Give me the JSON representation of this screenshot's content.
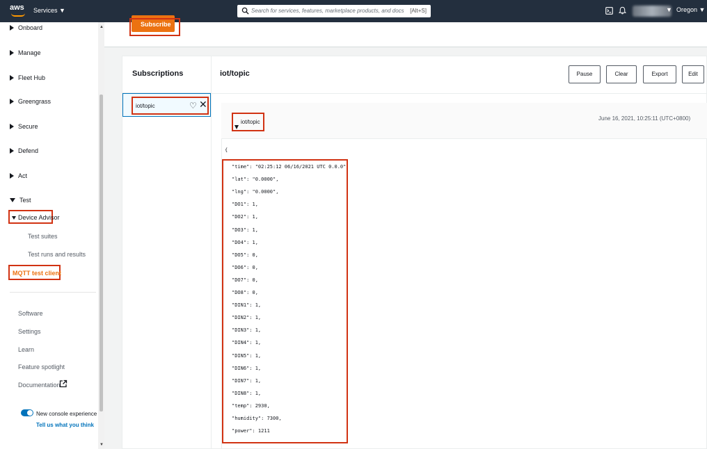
{
  "topnav": {
    "logo": "aws",
    "services_label": "Services ▼",
    "search_placeholder": "Search for services, features, marketplace products, and docs",
    "search_shortcut": "[Alt+S]",
    "region_label": "Oregon ▼",
    "user_caret": "▼"
  },
  "sidebar": {
    "items": [
      {
        "label": "Onboard"
      },
      {
        "label": "Manage"
      },
      {
        "label": "Fleet Hub"
      },
      {
        "label": "Greengrass"
      },
      {
        "label": "Secure"
      },
      {
        "label": "Defend"
      },
      {
        "label": "Act"
      },
      {
        "label": "Test"
      }
    ],
    "test_children": {
      "device_advisor": "Device Advisor",
      "test_suites": "Test suites",
      "test_runs": "Test runs and results",
      "mqtt_test_client": "MQTT test client"
    },
    "footer": {
      "software": "Software",
      "settings": "Settings",
      "learn": "Learn",
      "feature_spotlight": "Feature spotlight",
      "documentation": "Documentation"
    },
    "console_toggle": {
      "label": "New console experience",
      "link": "Tell us what you think"
    }
  },
  "main": {
    "subscribe_label": "Subscribe",
    "subscriptions_title": "Subscriptions",
    "topic_title": "iot/topic",
    "buttons": {
      "pause": "Pause",
      "clear": "Clear",
      "export": "Export",
      "edit": "Edit"
    },
    "subscription_item": "iot/topic",
    "message": {
      "topic": "iot/topic",
      "timestamp": "June 16, 2021, 10:25:11 (UTC+0800)",
      "json_lines": [
        "{",
        "\"time\": \"02:25:12 06/16/2021 UTC 0.0.0\",",
        "\"lat\": \"0.0000\",",
        "\"lng\": \"0.0000\",",
        "\"DO1\": 1,",
        "\"DO2\": 1,",
        "\"DO3\": 1,",
        "\"DO4\": 1,",
        "\"DO5\": 0,",
        "\"DO6\": 0,",
        "\"DO7\": 0,",
        "\"DO8\": 0,",
        "\"DIN1\": 1,",
        "\"DIN2\": 1,",
        "\"DIN3\": 1,",
        "\"DIN4\": 1,",
        "\"DIN5\": 1,",
        "\"DIN6\": 1,",
        "\"DIN7\": 1,",
        "\"DIN8\": 1,",
        "\"temp\": 2930,",
        "\"humidity\": 7300,",
        "\"power\": 1211"
      ]
    }
  },
  "colors": {
    "nav_bg": "#232f3e",
    "accent_orange": "#ec7211",
    "highlight_red": "#d13212",
    "link_blue": "#0073bb"
  }
}
